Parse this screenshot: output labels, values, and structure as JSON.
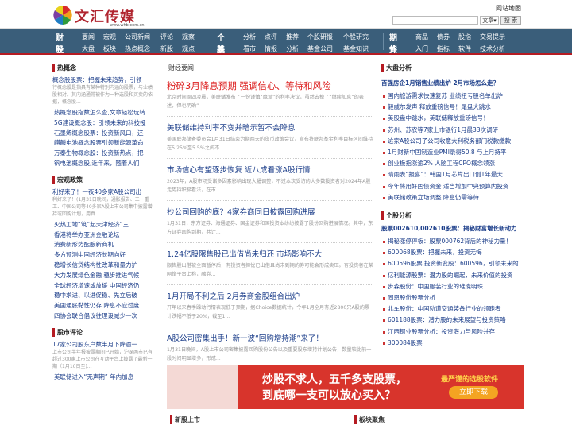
{
  "header": {
    "logo_text": "文汇传媒",
    "logo_url": "www.whb.com.cn",
    "sitemap": "网站地图",
    "search_placeholder": "",
    "search_select": "文章▾",
    "search_button": "搜 索"
  },
  "nav": {
    "groups": [
      {
        "h1": "财经",
        "h2": "股票",
        "row1": [
          "要闻",
          "宏观",
          "公司新闻",
          "评论",
          "观察"
        ],
        "row2": [
          "大盘",
          "板块",
          "热点概念",
          "新股",
          "观点"
        ]
      },
      {
        "h1": "个股",
        "h2": "基金",
        "row1": [
          "分析",
          "点评",
          "推荐",
          "个股研报",
          "个股研究"
        ],
        "row2": [
          "看市",
          "情报",
          "分析",
          "基金公司",
          "基金知识"
        ]
      },
      {
        "h1": "期货",
        "h2": "外汇",
        "row1": [
          "商品",
          "债券",
          "股指",
          "交易提示"
        ],
        "row2": [
          "入门",
          "指标",
          "软件",
          "技术分析"
        ]
      }
    ]
  },
  "left": {
    "sec1_title": "热概念",
    "sec1_lead": "概念股股票：把握未来趋势，引领",
    "sec1_desc": "行概念股是指具有某种特别内涵的股票，与业绩股相对。其内涵通常被作为一种选股和买卖的依据，概念股...",
    "sec1_items": [
      "热概念股指数怎么查,文章轻松玩转",
      "5G建设概念股：引领未来的科技投",
      "石墨烯概念股票：投资新风口，还",
      "麒麟电池概念股票引领新能源革命",
      "万泰生物概念股：投资新热点，把",
      "钒电池概念股,近年来，随着人们"
    ],
    "sec2_title": "宏观政策",
    "sec2_lead": "利好来了！一夜40多家A股公司出",
    "sec2_desc": "利好来了！(1月31日晚间，通胀报告、三一重工、中国公司等40多家A股上市公司集中披露增持或回购计划，用真...",
    "sec2_items": [
      "火热工地“筑”起天津经济“三",
      "香港将举办亚洲金融论坛",
      "消费新形势酝酿新商机",
      "多方预测中国经济长期向好",
      "稳增长信贷结构性改革和量力扩",
      "大力发展绿色金融 稳步推进气候",
      "全球经济增速或放缓 中国经济仍",
      "稳中求进、以进促稳、先立后破",
      "美国通胀黏性仍存 降息不应过度",
      "四协会联合倡议往理设减少一次"
    ],
    "sec3_title": "股市评论",
    "sec3_lead": "17家公司股东户数半月下降逾一",
    "sec3_desc": "上市公司半年报披露期间已开始，沪深两市已有超过300家上市公司在互动平台上披露了最新一期（1月10日至)…",
    "sec3_item": "美联储进入“无声期” 年内加息"
  },
  "middle": {
    "title": "财经要闻",
    "articles": [
      {
        "t": "粉碎3月降息预期 强调信心、等待和风险",
        "d": "北京时间周四凌晨，美联储发布了一份谨慎“鹰派”的利率决议，虽然去掉了“继续加息”的表述，但也明确”"
      },
      {
        "t": "美联储维持利率不变并暗示暂不会降息",
        "d": "美国联邦储备委员会1月31日结束为期两天的货币政策会议，宣布将联邦基金利率目标区间维持在5.25%至5.5%之间不..."
      },
      {
        "t": "市场信心有望逐步恢复 近八成看涨A股行情",
        "d": "2023年，A股市场受诸多因素影响出现大幅调整，不过本次受访的大多数投资者对2024年A股走势持积极看法，在市..."
      },
      {
        "t": "抄公司回购的底？4家券商同日披露回购进展",
        "d": "1月31日，东方证券、海通证券、国金证券和国投资本纷纷披露了股份回购进展情况。其中，东方证券回购到期，共计..."
      },
      {
        "t": "1.24亿股限售股已出借尚未归还 市场影响不大",
        "d": "限售股出借被全面暂停后，有投资者担忧已出借且尚未到期的券可能会形成卖压。有投资者在某网络平台上称，融券..."
      },
      {
        "t": "1月开局不利之后 2月券商金股组合出炉",
        "d": "开年以来春季躁动行情表现低于预期，据Choice数据统计，今年1月全月有近2800只A股的累计跌幅不低于20%，截至1..."
      },
      {
        "t": "A股公司密集出手！新一波“回购增持潮”来了！",
        "d": "1月31日晚间，A股上市公司密集披露回购股份公告以及重要股东增持计划公告，数量较此前一段时间明显增多，形成..."
      }
    ]
  },
  "right": {
    "sec1_title": "大盘分析",
    "sec1_head": "百强房企1月销售业绩出炉 2月市场怎么走？",
    "sec1_items": [
      "国内旅游需求快速复苏 业绩扭亏股名单出炉",
      "毅威尔发声 释放重磅信号！尾盘大跳水",
      "美股盘中跳水，美联储释放重磅信号！",
      "苏州、苏农等7家上市银行1月晨33次调研",
      "这家A股公司子公司收意大利税务部门税款缴款",
      "1月财新中国制造业PMI录得50.8 与上月持平",
      "创业板指涨逾2% 人脑工程CPO概念领涨",
      "晴雨表“报喜”：韩国1月芯片出口创1年最大",
      "今年将用好国债资金 适当增加中央预算内投资",
      "美联储政策立场调整 降息仍需等待"
    ],
    "sec2_title": "个股分析",
    "sec2_head": "股票002610,002610股票：揭秘财富增长新动力",
    "sec2_items": [
      "揭秘涨停停板：股票000762背后的神秘力量！",
      "600068股票：把握未来，投资无悔",
      "600596股票,投资新变股：600596，引领未来的",
      "亿利能源股票：潜力股的崛起，未来价值的投资",
      "步森股份：中国服装行业的璀璨明珠",
      "固恩股份股票分析",
      "北车股份：中国轨道交通装备行业的领跑者",
      "601188股票：潜力股的未来展望与投资策略",
      "江西铜业股票分析：投资潜力与风险并存",
      "300084股票"
    ]
  },
  "banner": {
    "line1": "炒股不求人，五千多支股票，",
    "line2": "到底哪一支可以放心买入？",
    "right_title": "最严谨的选股软件",
    "right_btn": "立即下载"
  },
  "bottom": {
    "left_title": "新股上市",
    "right_title": "板块聚焦"
  }
}
